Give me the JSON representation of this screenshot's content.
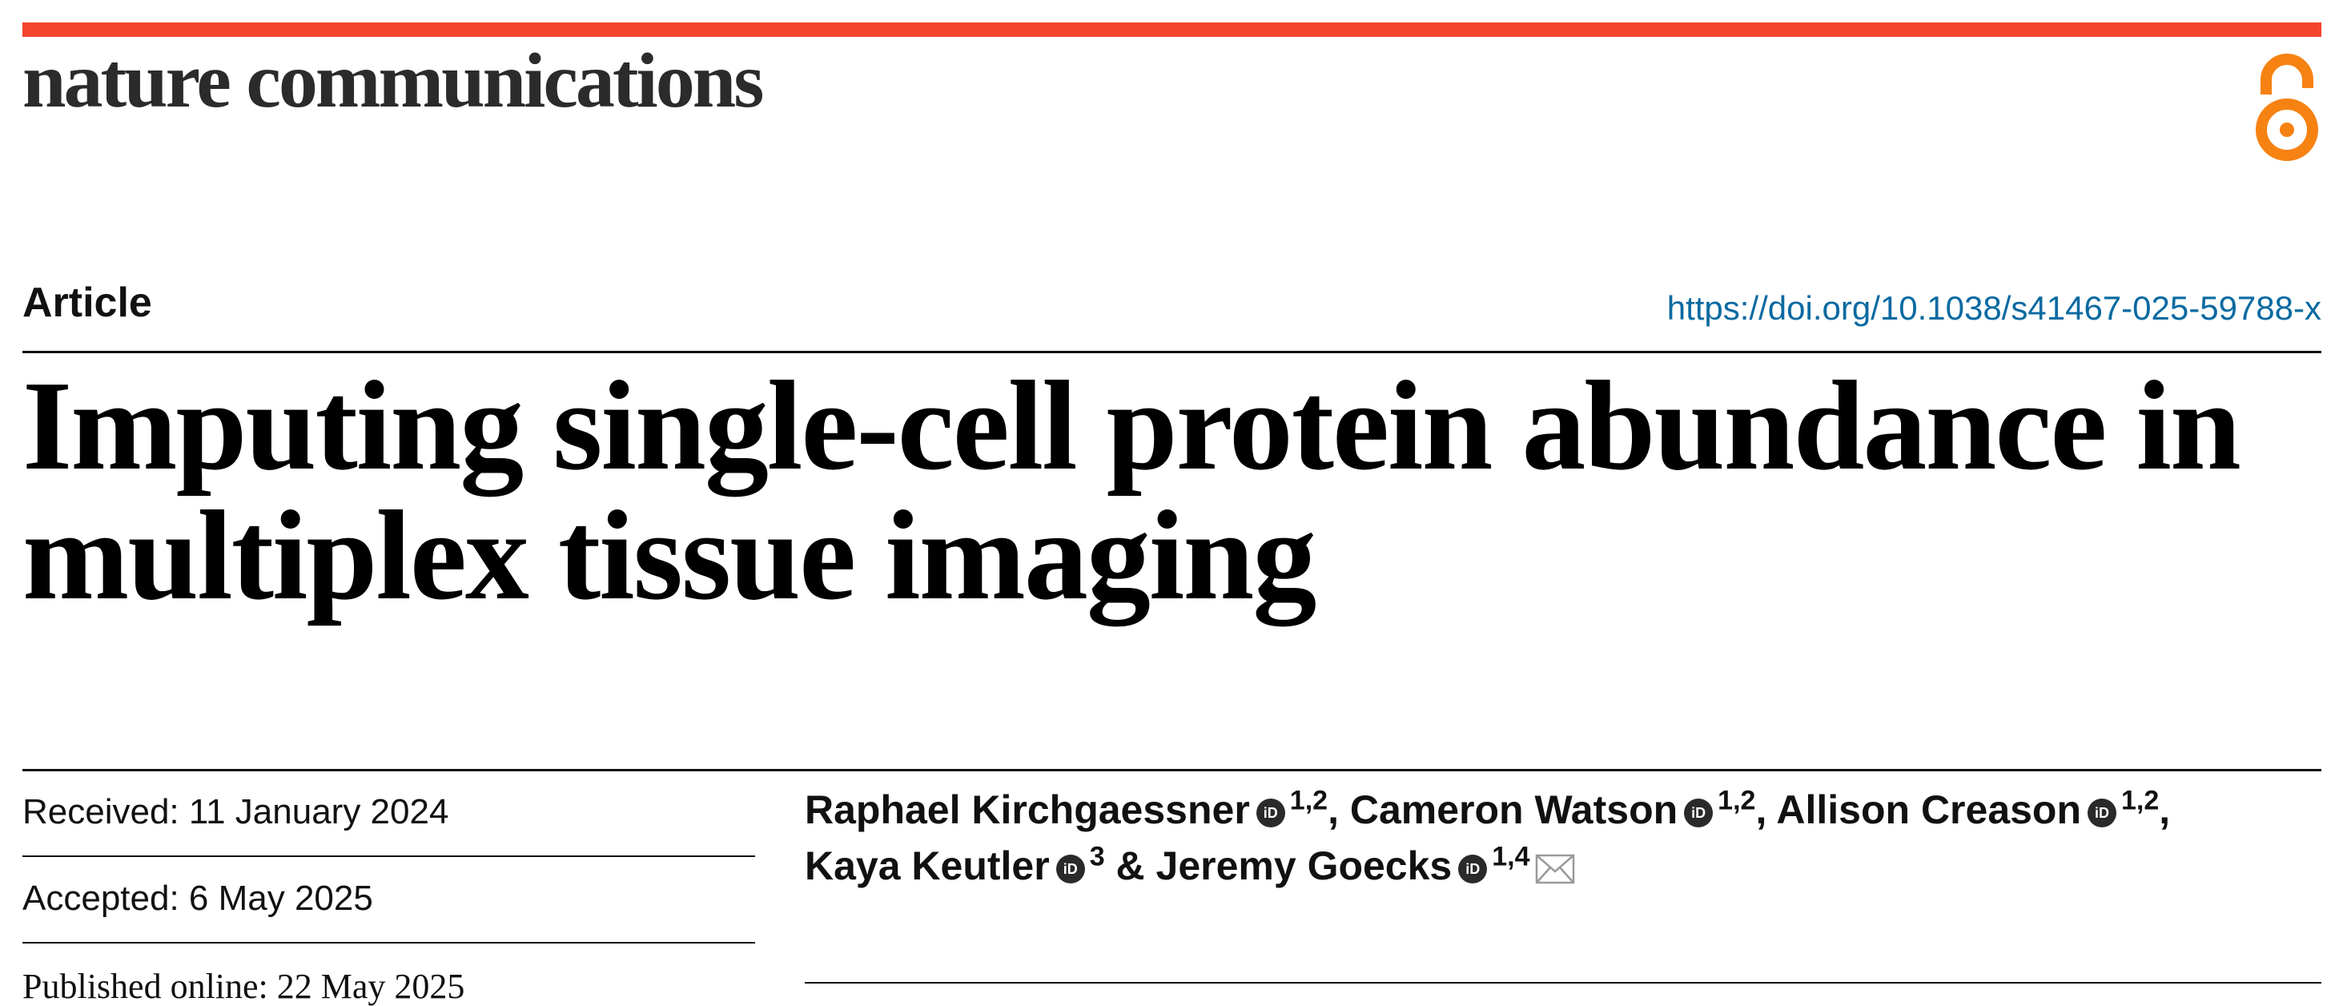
{
  "journal": {
    "name": "nature communications",
    "accent_color": "#f4442e",
    "open_access_icon": "open-access-icon",
    "open_access_color": "#f68212"
  },
  "article": {
    "type": "Article",
    "doi_url": "https://doi.org/10.1038/s41467-025-59788-x",
    "title": "Imputing single-cell protein abundance in multiplex tissue imaging"
  },
  "dates": {
    "received": "Received: 11 January 2024",
    "accepted": "Accepted: 6 May 2025",
    "published": "Published online: 22 May 2025"
  },
  "authors": [
    {
      "name": "Raphael Kirchgaessner",
      "affiliations": "1,2",
      "sep": ", "
    },
    {
      "name": "Cameron Watson",
      "affiliations": "1,2",
      "sep": ", "
    },
    {
      "name": "Allison Creason",
      "affiliations": "1,2",
      "sep": ","
    },
    {
      "name": "Kaya Keutler",
      "affiliations": "3",
      "sep": " & "
    },
    {
      "name": "Jeremy Goecks",
      "affiliations": "1,4",
      "sep": ""
    }
  ],
  "orcid_label": "iD",
  "icons": {
    "orcid": "orcid-icon",
    "mail": "mail-icon"
  }
}
